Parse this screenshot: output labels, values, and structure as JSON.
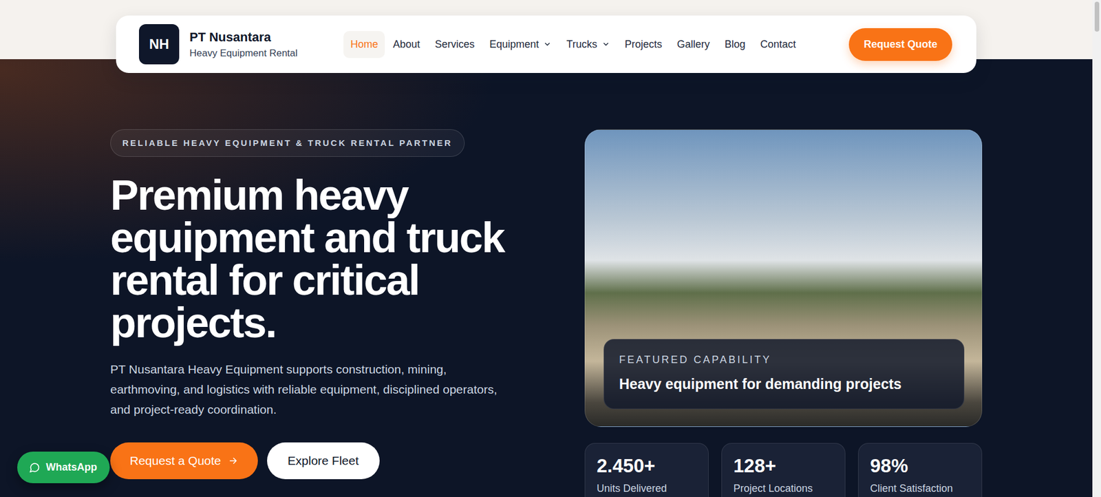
{
  "brand": {
    "logo": "NH",
    "name": "PT Nusantara",
    "tagline": "Heavy Equipment Rental"
  },
  "nav": {
    "links": [
      {
        "label": "Home",
        "selected": true,
        "dropdown": false
      },
      {
        "label": "About",
        "selected": false,
        "dropdown": false
      },
      {
        "label": "Services",
        "selected": false,
        "dropdown": false
      },
      {
        "label": "Equipment",
        "selected": false,
        "dropdown": true
      },
      {
        "label": "Trucks",
        "selected": false,
        "dropdown": true
      },
      {
        "label": "Projects",
        "selected": false,
        "dropdown": false
      },
      {
        "label": "Gallery",
        "selected": false,
        "dropdown": false
      },
      {
        "label": "Blog",
        "selected": false,
        "dropdown": false
      },
      {
        "label": "Contact",
        "selected": false,
        "dropdown": false
      }
    ],
    "cta": "Request Quote"
  },
  "hero": {
    "badge": "RELIABLE HEAVY EQUIPMENT & TRUCK RENTAL PARTNER",
    "title": "Premium heavy equipment and truck rental for critical projects.",
    "description": "PT Nusantara Heavy Equipment supports construction, mining, earthmoving, and logistics with reliable equipment, disciplined operators, and project-ready coordination.",
    "primary_button": "Request a Quote",
    "secondary_button": "Explore Fleet"
  },
  "feature": {
    "eyebrow": "FEATURED CAPABILITY",
    "title": "Heavy equipment for demanding projects"
  },
  "stats": [
    {
      "value": "2.450+",
      "label": "Units Delivered"
    },
    {
      "value": "128+",
      "label": "Project Locations"
    },
    {
      "value": "98%",
      "label": "Client Satisfaction"
    }
  ],
  "whatsapp": {
    "label": "WhatsApp"
  }
}
